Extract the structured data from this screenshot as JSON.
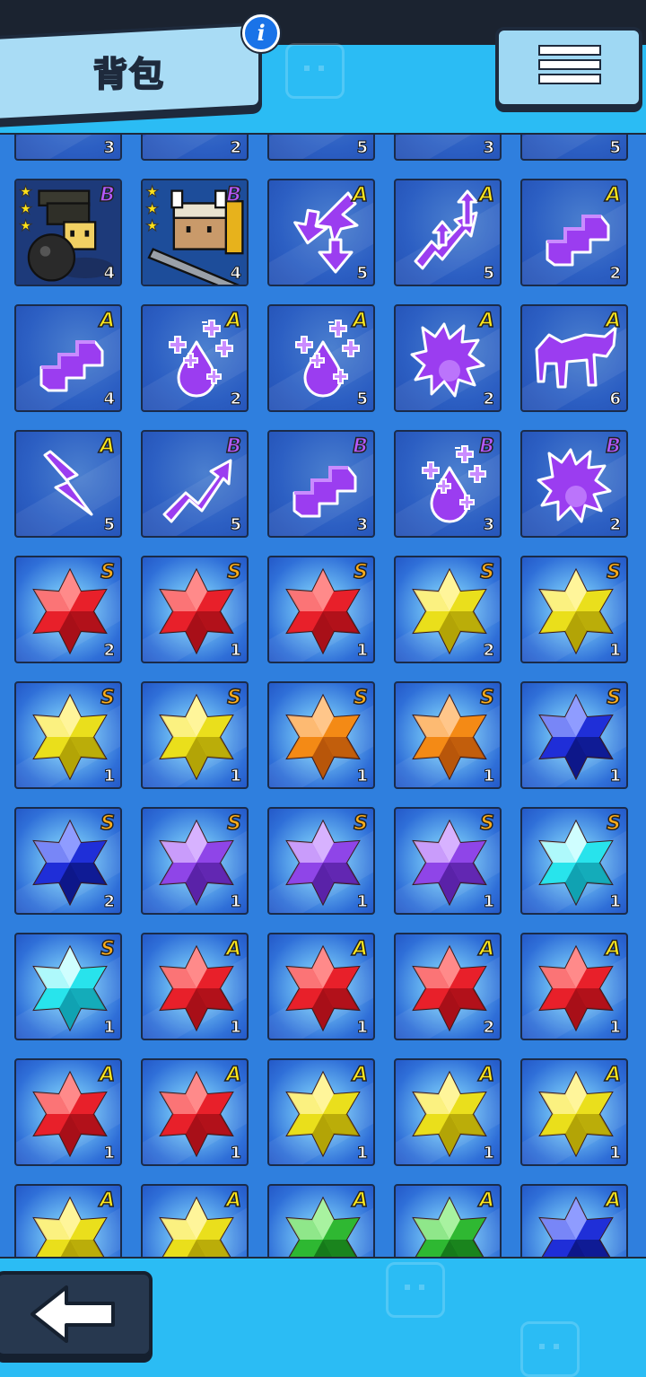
{
  "header": {
    "title": "背包",
    "info_icon": "info-icon",
    "menu_icon": "hamburger-menu-icon"
  },
  "footer": {
    "back_icon": "back-arrow-icon"
  },
  "colors": {
    "background": "#2bbcf4",
    "panel": "#2f7fde",
    "grade_S": "#ffae1a",
    "grade_A": "#ffe81c",
    "grade_B": "#b559ff",
    "gem_red": "#e8202a",
    "gem_yellow": "#eadf1c",
    "gem_orange": "#f48a15",
    "gem_blue": "#1f2fd8",
    "gem_purple": "#8f45e8",
    "gem_cyan": "#28e3ec",
    "gem_green": "#2fb832"
  },
  "inventory": {
    "rows": [
      [
        {
          "icon": "sword-icon",
          "grade": "",
          "count": "3"
        },
        {
          "icon": "sword-icon",
          "grade": "",
          "count": "2"
        },
        {
          "icon": "sword-icon",
          "grade": "",
          "count": "5"
        },
        {
          "icon": "helmet-icon",
          "grade": "",
          "count": "3"
        },
        {
          "icon": "sword-icon",
          "grade": "",
          "count": "5"
        }
      ],
      [
        {
          "icon": "bomber-character-icon",
          "grade": "B",
          "count": "4",
          "stars": 3
        },
        {
          "icon": "knight-character-icon",
          "grade": "B",
          "count": "4",
          "stars": 3
        },
        {
          "icon": "swap-arrows-icon",
          "grade": "A",
          "count": "5"
        },
        {
          "icon": "up-arrows-icon",
          "grade": "A",
          "count": "5"
        },
        {
          "icon": "purple-steps-icon",
          "grade": "A",
          "count": "2"
        }
      ],
      [
        {
          "icon": "purple-steps-icon",
          "grade": "A",
          "count": "4"
        },
        {
          "icon": "purple-drop-icon",
          "grade": "A",
          "count": "2"
        },
        {
          "icon": "purple-drop-icon",
          "grade": "A",
          "count": "5"
        },
        {
          "icon": "purple-dragon-icon",
          "grade": "A",
          "count": "2"
        },
        {
          "icon": "purple-beast-icon",
          "grade": "A",
          "count": "6"
        }
      ],
      [
        {
          "icon": "purple-lightning-icon",
          "grade": "A",
          "count": "5"
        },
        {
          "icon": "purple-trend-icon",
          "grade": "B",
          "count": "5"
        },
        {
          "icon": "purple-steps-icon",
          "grade": "B",
          "count": "3"
        },
        {
          "icon": "purple-drop-icon",
          "grade": "B",
          "count": "3"
        },
        {
          "icon": "purple-dragon-icon",
          "grade": "B",
          "count": "2"
        }
      ],
      [
        {
          "icon": "gem-red",
          "grade": "S",
          "count": "2"
        },
        {
          "icon": "gem-red",
          "grade": "S",
          "count": "1"
        },
        {
          "icon": "gem-red",
          "grade": "S",
          "count": "1"
        },
        {
          "icon": "gem-yellow",
          "grade": "S",
          "count": "2"
        },
        {
          "icon": "gem-yellow",
          "grade": "S",
          "count": "1"
        }
      ],
      [
        {
          "icon": "gem-yellow",
          "grade": "S",
          "count": "1"
        },
        {
          "icon": "gem-yellow",
          "grade": "S",
          "count": "1"
        },
        {
          "icon": "gem-orange",
          "grade": "S",
          "count": "1"
        },
        {
          "icon": "gem-orange",
          "grade": "S",
          "count": "1"
        },
        {
          "icon": "gem-blue",
          "grade": "S",
          "count": "1"
        }
      ],
      [
        {
          "icon": "gem-blue",
          "grade": "S",
          "count": "2"
        },
        {
          "icon": "gem-purple",
          "grade": "S",
          "count": "1"
        },
        {
          "icon": "gem-purple",
          "grade": "S",
          "count": "1"
        },
        {
          "icon": "gem-purple",
          "grade": "S",
          "count": "1"
        },
        {
          "icon": "gem-cyan",
          "grade": "S",
          "count": "1"
        }
      ],
      [
        {
          "icon": "gem-cyan",
          "grade": "S",
          "count": "1"
        },
        {
          "icon": "gem-red",
          "grade": "A",
          "count": "1"
        },
        {
          "icon": "gem-red",
          "grade": "A",
          "count": "1"
        },
        {
          "icon": "gem-red",
          "grade": "A",
          "count": "2"
        },
        {
          "icon": "gem-red",
          "grade": "A",
          "count": "1"
        }
      ],
      [
        {
          "icon": "gem-red",
          "grade": "A",
          "count": "1"
        },
        {
          "icon": "gem-red",
          "grade": "A",
          "count": "1"
        },
        {
          "icon": "gem-yellow",
          "grade": "A",
          "count": "1"
        },
        {
          "icon": "gem-yellow",
          "grade": "A",
          "count": "1"
        },
        {
          "icon": "gem-yellow",
          "grade": "A",
          "count": "1"
        }
      ],
      [
        {
          "icon": "gem-yellow",
          "grade": "A",
          "count": ""
        },
        {
          "icon": "gem-yellow",
          "grade": "A",
          "count": ""
        },
        {
          "icon": "gem-green",
          "grade": "A",
          "count": ""
        },
        {
          "icon": "gem-green",
          "grade": "A",
          "count": ""
        },
        {
          "icon": "gem-blue",
          "grade": "A",
          "count": ""
        }
      ]
    ]
  }
}
